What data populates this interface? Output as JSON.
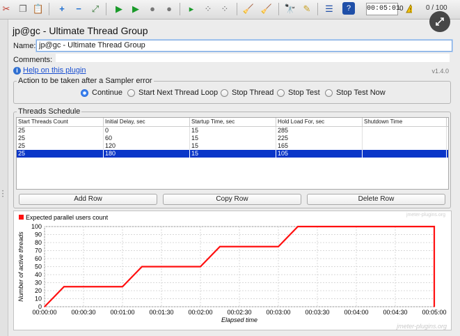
{
  "toolbar": {
    "elapsed_time": "00:05:01",
    "active_threads": "0 / 100",
    "warning_count": "0"
  },
  "title": "jp@gc - Ultimate Thread Group",
  "name_label": "Name:",
  "name_value": "jp@gc - Ultimate Thread Group",
  "comments_label": "Comments:",
  "help_link": "Help on this plugin",
  "version": "v1.4.0",
  "action_group": {
    "legend": "Action to be taken after a Sampler error",
    "options": [
      "Continue",
      "Start Next Thread Loop",
      "Stop Thread",
      "Stop Test",
      "Stop Test Now"
    ],
    "selected": "Continue"
  },
  "schedule": {
    "legend": "Threads Schedule",
    "columns": [
      "Start Threads Count",
      "Initial Delay, sec",
      "Startup Time, sec",
      "Hold Load For, sec",
      "Shutdown Time"
    ],
    "rows": [
      [
        "25",
        "0",
        "15",
        "285",
        ""
      ],
      [
        "25",
        "60",
        "15",
        "225",
        ""
      ],
      [
        "25",
        "120",
        "15",
        "165",
        ""
      ],
      [
        "25",
        "180",
        "15",
        "105",
        ""
      ]
    ],
    "selected_row": 3
  },
  "buttons": {
    "add": "Add Row",
    "copy": "Copy Row",
    "delete": "Delete Row"
  },
  "watermark_top": "jmeter-plugins.org",
  "watermark_bottom": "jmeter-plugins.org",
  "chart_data": {
    "type": "line",
    "legend": [
      "Expected parallel users count"
    ],
    "legend_position": "top-left",
    "series": [
      {
        "name": "Expected parallel users count",
        "color": "#ff1010",
        "x": [
          0,
          15,
          60,
          75,
          120,
          135,
          180,
          195,
          300,
          300
        ],
        "y": [
          0,
          25,
          25,
          50,
          50,
          75,
          75,
          100,
          100,
          0
        ]
      }
    ],
    "xticks": [
      "00:00:00",
      "00:00:30",
      "00:01:00",
      "00:01:30",
      "00:02:00",
      "00:02:30",
      "00:03:00",
      "00:03:30",
      "00:04:00",
      "00:04:30",
      "00:05:00"
    ],
    "xtick_values": [
      0,
      30,
      60,
      90,
      120,
      150,
      180,
      210,
      240,
      270,
      300
    ],
    "yticks": [
      "0",
      "10",
      "20",
      "30",
      "40",
      "50",
      "60",
      "70",
      "80",
      "90",
      "100"
    ],
    "ytick_values": [
      0,
      10,
      20,
      30,
      40,
      50,
      60,
      70,
      80,
      90,
      100
    ],
    "xlim": [
      0,
      300
    ],
    "ylim": [
      0,
      100
    ],
    "xlabel": "Elapsed time",
    "ylabel": "Number of active threads",
    "grid": true
  }
}
